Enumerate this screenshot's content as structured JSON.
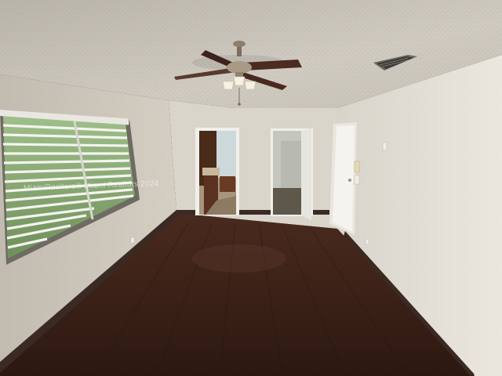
{
  "scene": {
    "description_name": "empty-bedroom-interior",
    "colors": {
      "ceiling": "#c9c4b9",
      "wall_back": "#dcd7cc",
      "wall_left": "#cfc9bd",
      "wall_right": "#e4dfd6",
      "floor": "#3a2219",
      "baseboard": "#3b2a24",
      "door": "#f1efea",
      "vanity": "#5a3220",
      "blinds": "#efeeea"
    },
    "icons": [
      "ceiling-fan-icon",
      "air-vent-icon",
      "window-blinds-icon",
      "light-switch-icon"
    ]
  },
  "watermark": {
    "text": "MiamiRealtors® Miami Realtors 2024"
  }
}
